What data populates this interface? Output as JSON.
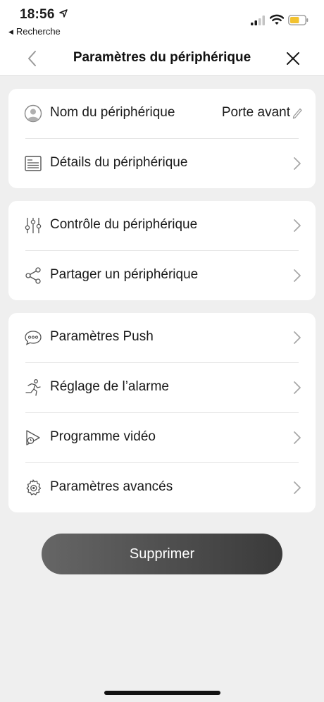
{
  "status_bar": {
    "time": "18:56",
    "back_app_label": "Recherche",
    "icons": [
      "location-arrow-icon",
      "signal-icon",
      "wifi-icon",
      "battery-icon"
    ],
    "battery_color": "#f2c230"
  },
  "nav": {
    "title": "Paramètres du périphérique",
    "back_icon": "chevron-left-icon",
    "close_icon": "close-icon"
  },
  "sections": [
    {
      "rows": [
        {
          "label": "Nom du périphérique",
          "value": "Porte avant",
          "icon": "user-avatar-icon",
          "action_icon": "pencil-icon"
        },
        {
          "label": "Détails du périphérique",
          "icon": "document-icon",
          "action_icon": "chevron-right-icon"
        }
      ]
    },
    {
      "rows": [
        {
          "label": "Contrôle du périphérique",
          "icon": "sliders-icon",
          "action_icon": "chevron-right-icon"
        },
        {
          "label": "Partager un périphérique",
          "icon": "share-icon",
          "action_icon": "chevron-right-icon"
        }
      ]
    },
    {
      "rows": [
        {
          "label": "Paramètres Push",
          "icon": "message-bubble-icon",
          "action_icon": "chevron-right-icon"
        },
        {
          "label": "Réglage de l’alarme",
          "icon": "running-person-icon",
          "action_icon": "chevron-right-icon"
        },
        {
          "label": "Programme vidéo",
          "icon": "video-schedule-icon",
          "action_icon": "chevron-right-icon"
        },
        {
          "label": "Paramètres avancés",
          "icon": "gear-icon",
          "action_icon": "chevron-right-icon"
        }
      ]
    }
  ],
  "delete_button": {
    "label": "Supprimer"
  },
  "colors": {
    "background": "#efefef",
    "card": "#ffffff",
    "button_gradient_start": "#666666",
    "button_gradient_end": "#3a3a3a"
  }
}
